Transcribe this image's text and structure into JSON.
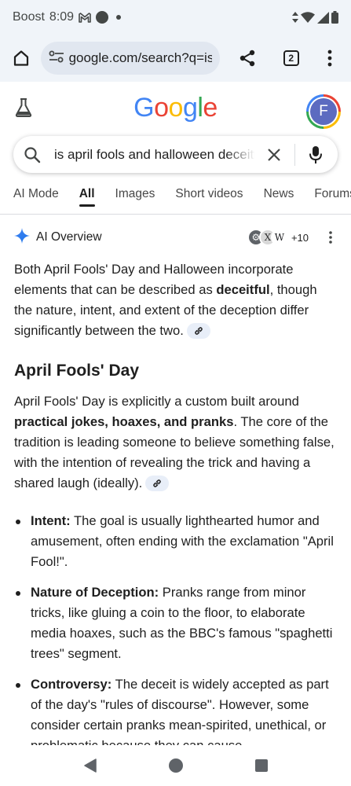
{
  "status_bar": {
    "carrier": "Boost",
    "time": "8:09",
    "icons": [
      "gmail-icon",
      "notification-dot-icon",
      "small-dot-icon",
      "data-arrows-icon",
      "wifi-icon",
      "signal-icon",
      "battery-icon"
    ]
  },
  "browser": {
    "url": "google.com/search?q=is",
    "tab_count": "2",
    "icons": [
      "home-icon",
      "site-settings-icon",
      "share-icon",
      "tabs-icon",
      "more-vert-icon"
    ]
  },
  "google": {
    "logo_letters": [
      "G",
      "o",
      "o",
      "g",
      "l",
      "e"
    ],
    "logo_colors": [
      "#4285f4",
      "#ea4335",
      "#fbbc05",
      "#4285f4",
      "#34a853",
      "#ea4335"
    ],
    "avatar_letter": "F",
    "avatar_color": "#5c6bc0"
  },
  "search": {
    "query": "is april fools and halloween deceitful"
  },
  "tabs": [
    {
      "label": "AI Mode",
      "active": false
    },
    {
      "label": "All",
      "active": true
    },
    {
      "label": "Images",
      "active": false
    },
    {
      "label": "Short videos",
      "active": false
    },
    {
      "label": "News",
      "active": false
    },
    {
      "label": "Forums",
      "active": false
    }
  ],
  "ai_overview": {
    "title": "AI Overview",
    "source_favicons": [
      "⚙",
      "X",
      "W"
    ],
    "sources_more": "+10",
    "intro": {
      "before": "Both April Fools' Day and Halloween incorporate elements that can be described as ",
      "bold": "deceitful",
      "after": ", though the nature, intent, and extent of the deception differ significantly between the two."
    },
    "section_heading": "April Fools' Day",
    "section_para": {
      "before": "April Fools' Day is explicitly a custom built around ",
      "bold": "practical jokes, hoaxes, and pranks",
      "after": ". The core of the tradition is leading someone to believe something false, with the intention of revealing the trick and having a shared laugh (ideally)."
    },
    "bullets": [
      {
        "label": "Intent:",
        "text": " The goal is usually lighthearted humor and amusement, often ending with the exclamation \"April Fool!\"."
      },
      {
        "label": "Nature of Deception:",
        "text": " Pranks range from minor tricks, like gluing a coin to the floor, to elaborate media hoaxes, such as the BBC's famous \"spaghetti trees\" segment."
      },
      {
        "label": "Controversy:",
        "text": " The deceit is widely accepted as part of the day's \"rules of discourse\". However, some consider certain pranks mean-spirited, unethical, or problematic because they can cause"
      }
    ]
  },
  "nav_bar": {
    "icons": [
      "back-icon",
      "home-circle-icon",
      "recents-icon"
    ]
  }
}
